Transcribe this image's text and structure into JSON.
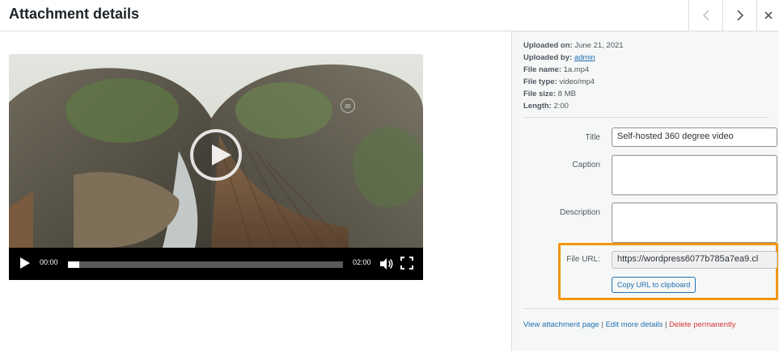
{
  "header": {
    "title": "Attachment details",
    "prev_icon": "chevron-left-icon",
    "next_icon": "chevron-right-icon",
    "close_icon": "close-icon"
  },
  "player": {
    "current_time": "00:00",
    "duration": "02:00",
    "progress_fraction": 0.04,
    "watermark": "æ",
    "play_icon": "play-icon",
    "volume_icon": "volume-icon",
    "fullscreen_icon": "fullscreen-icon"
  },
  "details": {
    "uploaded_on_label": "Uploaded on:",
    "uploaded_on_value": "June 21, 2021",
    "uploaded_by_label": "Uploaded by:",
    "uploaded_by_value": "admin",
    "file_name_label": "File name:",
    "file_name_value": "1a.mp4",
    "file_type_label": "File type:",
    "file_type_value": "video/mp4",
    "file_size_label": "File size:",
    "file_size_value": "8 MB",
    "length_label": "Length:",
    "length_value": "2:00"
  },
  "form": {
    "title_label": "Title",
    "title_value": "Self-hosted 360 degree video",
    "caption_label": "Caption",
    "caption_value": "",
    "description_label": "Description",
    "description_value": "",
    "file_url_label": "File URL:",
    "file_url_value": "https://wordpress6077b785a7ea9.cl",
    "copy_button": "Copy URL to clipboard"
  },
  "actions": {
    "view": "View attachment page",
    "sep1": " | ",
    "edit": "Edit more details",
    "sep2": " | ",
    "delete": "Delete permanently"
  },
  "colors": {
    "link": "#2271b1",
    "delete": "#d63638",
    "highlight": "#f0960e",
    "sidebar_bg": "#f6f7f7"
  }
}
